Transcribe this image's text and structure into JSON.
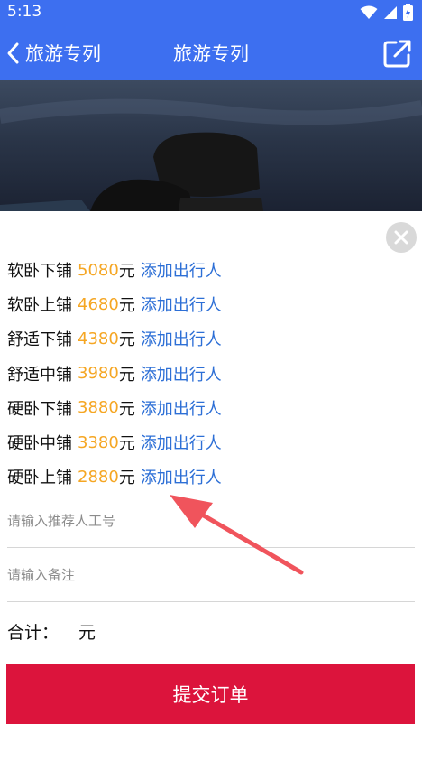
{
  "status_bar": {
    "time": "5:13",
    "icons": [
      "wifi-icon",
      "signal-icon",
      "battery-icon"
    ]
  },
  "nav": {
    "back_label": "旅游专列",
    "title": "旅游专列",
    "share_icon": "share-icon"
  },
  "hero": {
    "icon": "hero-image"
  },
  "tickets": [
    {
      "name": "软卧下铺",
      "price": "5080",
      "unit": "元",
      "action": "添加出行人"
    },
    {
      "name": "软卧上铺",
      "price": "4680",
      "unit": "元",
      "action": "添加出行人"
    },
    {
      "name": "舒适下铺",
      "price": "4380",
      "unit": "元",
      "action": "添加出行人"
    },
    {
      "name": "舒适中铺",
      "price": "3980",
      "unit": "元",
      "action": "添加出行人"
    },
    {
      "name": "硬卧下铺",
      "price": "3880",
      "unit": "元",
      "action": "添加出行人"
    },
    {
      "name": "硬卧中铺",
      "price": "3380",
      "unit": "元",
      "action": "添加出行人"
    },
    {
      "name": "硬卧上铺",
      "price": "2880",
      "unit": "元",
      "action": "添加出行人"
    }
  ],
  "form": {
    "referrer_placeholder": "请输入推荐人工号",
    "referrer_value": "",
    "note_placeholder": "请输入备注",
    "note_value": ""
  },
  "total": {
    "label": "合计：",
    "value": "",
    "unit": "元"
  },
  "submit_label": "提交订单",
  "colors": {
    "nav_bg": "#3d6ff0",
    "price": "#f5a623",
    "link": "#2d6fd6",
    "submit_bg": "#dc143c",
    "annotation_arrow": "#f0545c"
  }
}
